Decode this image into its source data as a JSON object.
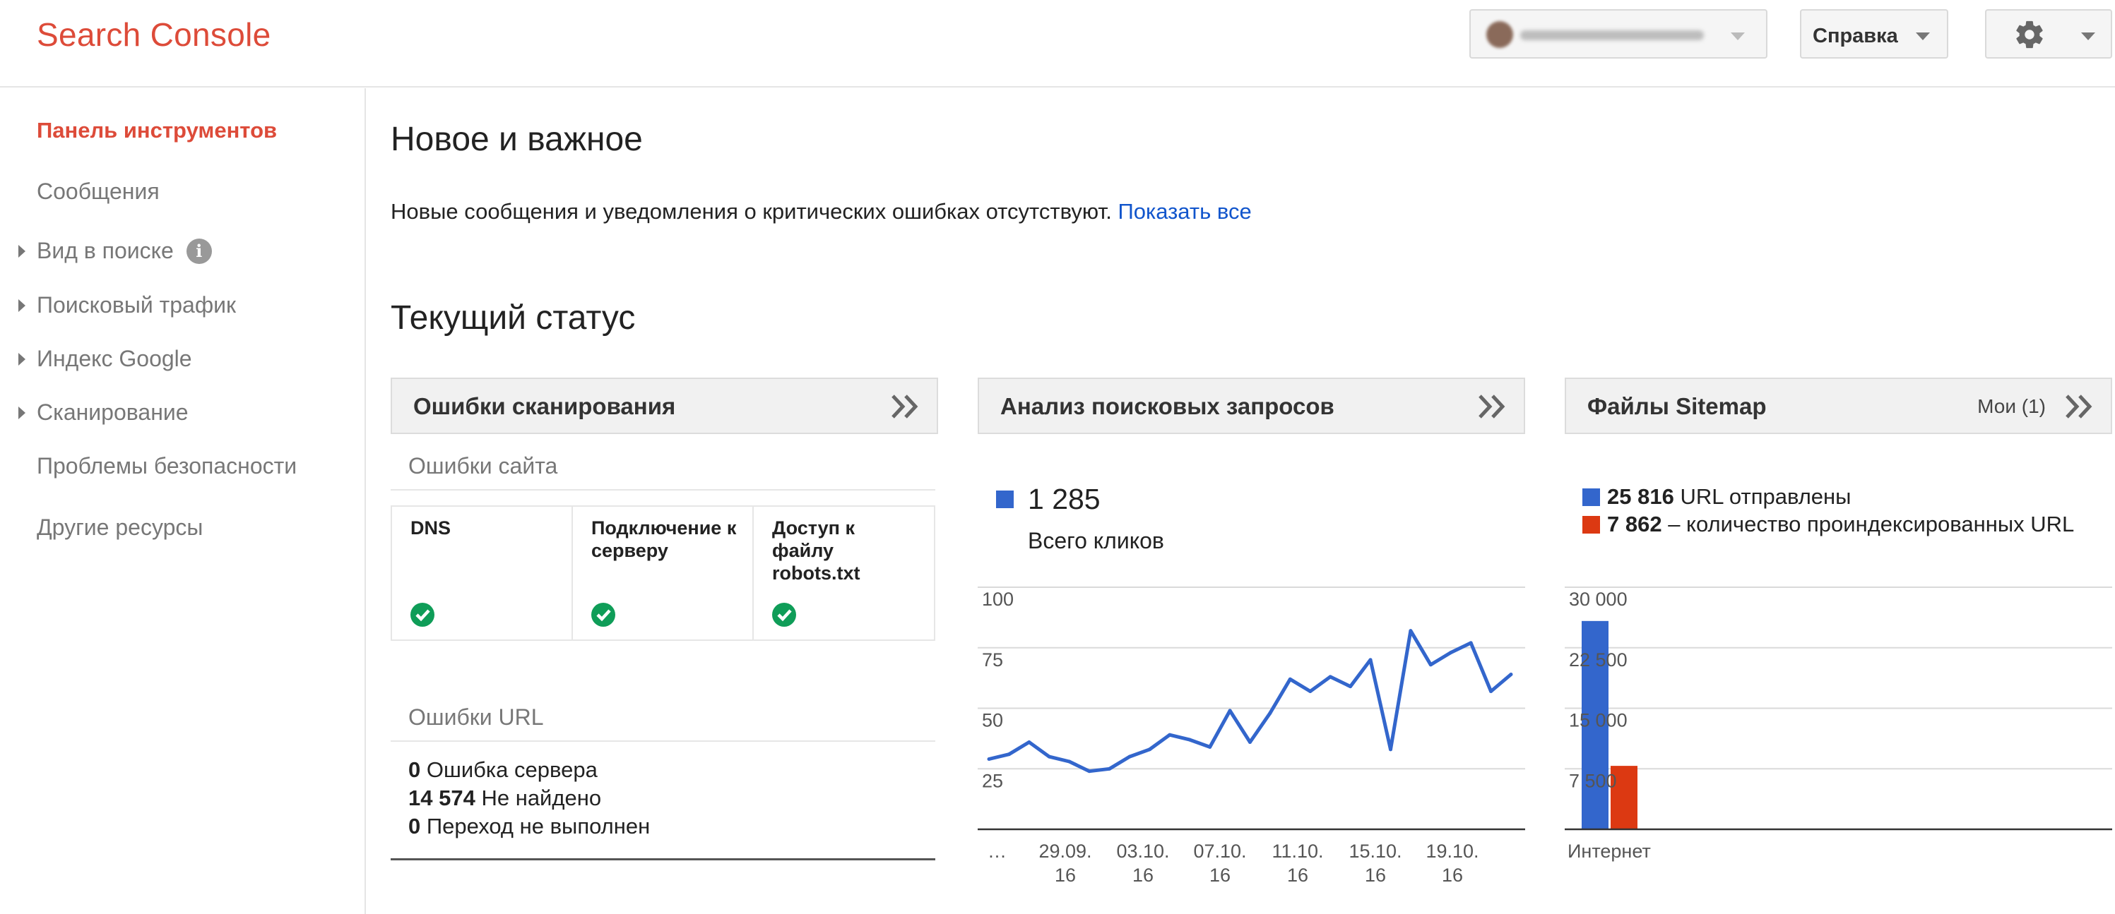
{
  "header": {
    "brand": "Search Console",
    "help_label": "Справка"
  },
  "sidebar": {
    "items": [
      {
        "label": "Панель инструментов",
        "active": true,
        "expandable": false
      },
      {
        "label": "Сообщения",
        "active": false,
        "expandable": false
      },
      {
        "label": "Вид в поиске",
        "active": false,
        "expandable": true,
        "info": true
      },
      {
        "label": "Поисковый трафик",
        "active": false,
        "expandable": true
      },
      {
        "label": "Индекс Google",
        "active": false,
        "expandable": true
      },
      {
        "label": "Сканирование",
        "active": false,
        "expandable": true
      },
      {
        "label": "Проблемы безопасности",
        "active": false,
        "expandable": false
      },
      {
        "label": "Другие ресурсы",
        "active": false,
        "expandable": false
      }
    ]
  },
  "main": {
    "new_title": "Новое и важное",
    "notice_text": "Новые сообщения и уведомления о критических ошибках отсутствуют.",
    "notice_link": "Показать все",
    "status_title": "Текущий статус"
  },
  "crawl_errors": {
    "title": "Ошибки сканирования",
    "site_errors_label": "Ошибки сайта",
    "cells": [
      {
        "label": "DNS",
        "status": "ok"
      },
      {
        "label": "Подключение к серверу",
        "status": "ok"
      },
      {
        "label": "Доступ к файлу robots.txt",
        "status": "ok"
      }
    ],
    "url_errors_label": "Ошибки URL",
    "url_errors": [
      {
        "count": "0",
        "label": "Ошибка сервера"
      },
      {
        "count": "14 574",
        "label": "Не найдено"
      },
      {
        "count": "0",
        "label": "Переход не выполнен"
      }
    ]
  },
  "search_analytics": {
    "title": "Анализ поисковых запросов",
    "total": "1 285",
    "total_label": "Всего кликов",
    "color": "#3366cc"
  },
  "sitemaps": {
    "title": "Файлы Sitemap",
    "mine_label": "Мои (1)",
    "submitted_count": "25 816",
    "submitted_label": "URL отправлены",
    "indexed_count": "7 862",
    "indexed_label": "– количество проиндексированных URL",
    "submitted_color": "#3366cc",
    "indexed_color": "#dc3912"
  },
  "chart_data": [
    {
      "type": "line",
      "series": [
        {
          "values": [
            29,
            31,
            36,
            30,
            28,
            24,
            25,
            30,
            33,
            39,
            37,
            34,
            49,
            36,
            48,
            62,
            57,
            63,
            59,
            70,
            33,
            82,
            68,
            73,
            77,
            57,
            64
          ]
        }
      ],
      "ylim": [
        0,
        100
      ],
      "yticks": [
        "100",
        "75",
        "50",
        "25"
      ],
      "xticks": [
        "…",
        "29.09.\n16",
        "03.10.\n16",
        "07.10.\n16",
        "11.10.\n16",
        "15.10.\n16",
        "19.10.\n16"
      ],
      "grid": true
    },
    {
      "type": "bar",
      "categories": [
        "Интернет"
      ],
      "series": [
        {
          "name": "URL отправлены",
          "values": [
            25816
          ],
          "color": "#3366cc"
        },
        {
          "name": "– количество проиндексированных URL",
          "values": [
            7862
          ],
          "color": "#dc3912"
        }
      ],
      "ylim": [
        0,
        30000
      ],
      "yticks": [
        "30 000",
        "22 500",
        "15 000",
        "7 500"
      ],
      "grid": true
    }
  ]
}
